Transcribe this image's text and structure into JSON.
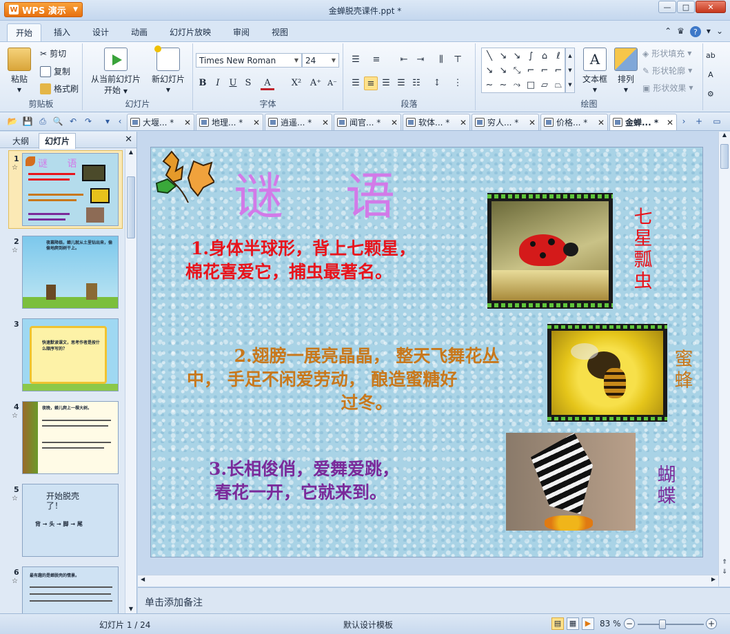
{
  "app": {
    "name": "WPS 演示",
    "window_title": "金蝉脱壳课件.ppt *"
  },
  "ribbon_tabs": [
    "开始",
    "插入",
    "设计",
    "动画",
    "幻灯片放映",
    "审阅",
    "视图"
  ],
  "ribbon": {
    "clipboard": {
      "paste": "粘贴",
      "cut": "剪切",
      "copy": "复制",
      "format_painter": "格式刷",
      "label": "剪贴板"
    },
    "slides": {
      "from_current": "从当前幻灯片",
      "start": "开始",
      "new_slide": "新幻灯片",
      "label": "幻灯片"
    },
    "font": {
      "name": "Times New Roman",
      "size": "24",
      "label": "字体"
    },
    "paragraph": {
      "label": "段落"
    },
    "drawing": {
      "textbox": "文本框",
      "arrange": "排列",
      "shape_fill": "形状填充",
      "shape_outline": "形状轮廓",
      "shape_effect": "形状效果",
      "label": "绘图"
    }
  },
  "doc_tabs": [
    {
      "label": "大堰... *"
    },
    {
      "label": "地理... *"
    },
    {
      "label": "逍遥... *"
    },
    {
      "label": "闻官... *"
    },
    {
      "label": "软体... *"
    },
    {
      "label": "穷人... *"
    },
    {
      "label": "价格... *"
    },
    {
      "label": "金蝉... *"
    }
  ],
  "left_panel": {
    "tabs": [
      "大纲",
      "幻灯片"
    ],
    "thumbs": [
      {
        "num": "1",
        "title": "谜 语"
      },
      {
        "num": "2",
        "text": "夜幕降临，蝉儿就从土里钻出来，偷偷地爬到树干上。"
      },
      {
        "num": "3",
        "text": "快速默读课文，思考作者是按什么顺序写的？"
      },
      {
        "num": "4",
        "text": "夜晚，蝉儿爬上一棵大树。"
      },
      {
        "num": "5",
        "title": "开始脱壳了！",
        "steps": "背 → 头 → 脚 → 尾"
      },
      {
        "num": "6",
        "text": "最有趣的是蝉脱壳的情景。"
      }
    ]
  },
  "slide": {
    "title": "谜语",
    "riddles": [
      {
        "line1": "1.身体半球形，背上七颗星，",
        "line2": "棉花喜爱它，捕虫最著名。",
        "answer": "七星瓢虫",
        "color": "#e8141c"
      },
      {
        "line1": "2.翅膀一展亮晶晶， 整天飞舞花丛",
        "line2": "中，     手足不闲爱劳动， 酿造蜜糖好",
        "line3": "过冬。",
        "answer": "蜜蜂",
        "color": "#c8781c"
      },
      {
        "line1": "3.长相俊俏，爱舞爱跳，",
        "line2": "春花一开，它就来到。",
        "answer": "蝴蝶",
        "color": "#7a2a9a"
      }
    ]
  },
  "notes_placeholder": "单击添加备注",
  "status": {
    "slide_index": "幻灯片 1 / 24",
    "template": "默认设计模板",
    "zoom": "83 %"
  }
}
